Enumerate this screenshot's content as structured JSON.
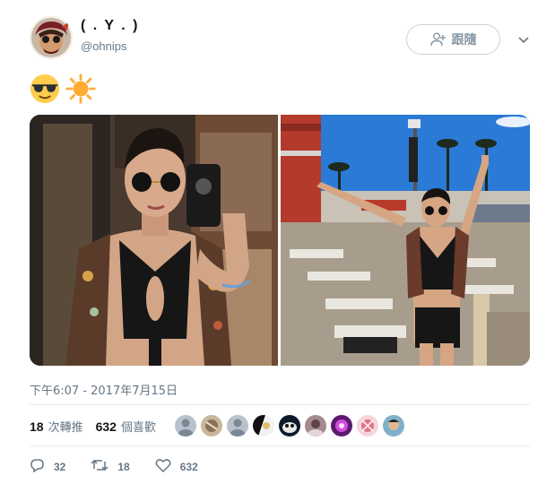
{
  "user": {
    "display_name": "( . Y . )",
    "handle": "@ohnips",
    "avatar_icon": "avatar-image"
  },
  "follow_button": {
    "label": "跟隨",
    "icon": "add-user-icon"
  },
  "menu_icon": "chevron-down-icon",
  "tweet": {
    "emojis": [
      "sunglasses-emoji",
      "sun-emoji"
    ],
    "photos": [
      "selfie-photo",
      "poolside-photo"
    ],
    "timestamp": "下午6:07 - 2017年7月15日"
  },
  "stats": {
    "retweets_count": "18",
    "retweets_label": "次轉推",
    "likes_count": "632",
    "likes_label": "個喜歡"
  },
  "likers_count": 9,
  "actions": {
    "reply_count": "32",
    "retweet_count": "18",
    "like_count": "632"
  },
  "colors": {
    "text": "#14171a",
    "secondary": "#657786",
    "border": "#e6ecf0",
    "button_border": "#c8d2da"
  }
}
